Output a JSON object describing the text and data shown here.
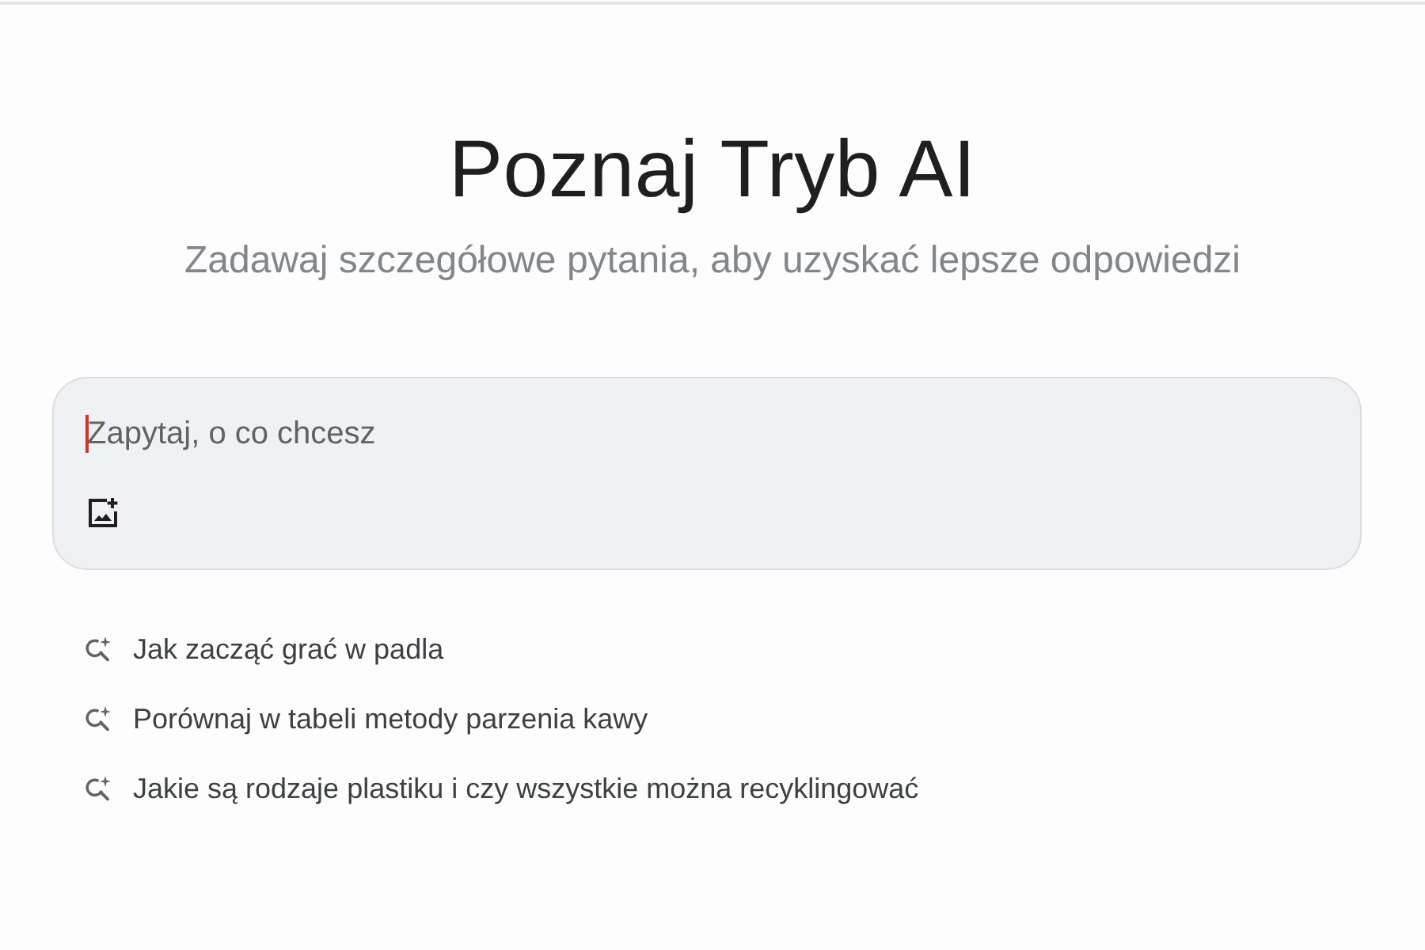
{
  "heading": {
    "title": "Poznaj Tryb AI",
    "subtitle": "Zadawaj szczegółowe pytania, aby uzyskać lepsze odpowiedzi"
  },
  "search": {
    "placeholder": "Zapytaj, o co chcesz",
    "focused": true
  },
  "suggestions": [
    {
      "text": "Jak zacząć grać w padla"
    },
    {
      "text": "Porównaj w tabeli metody parzenia kawy"
    },
    {
      "text": "Jakie są rodzaje plastiku i czy wszystkie można recyklingować"
    }
  ]
}
